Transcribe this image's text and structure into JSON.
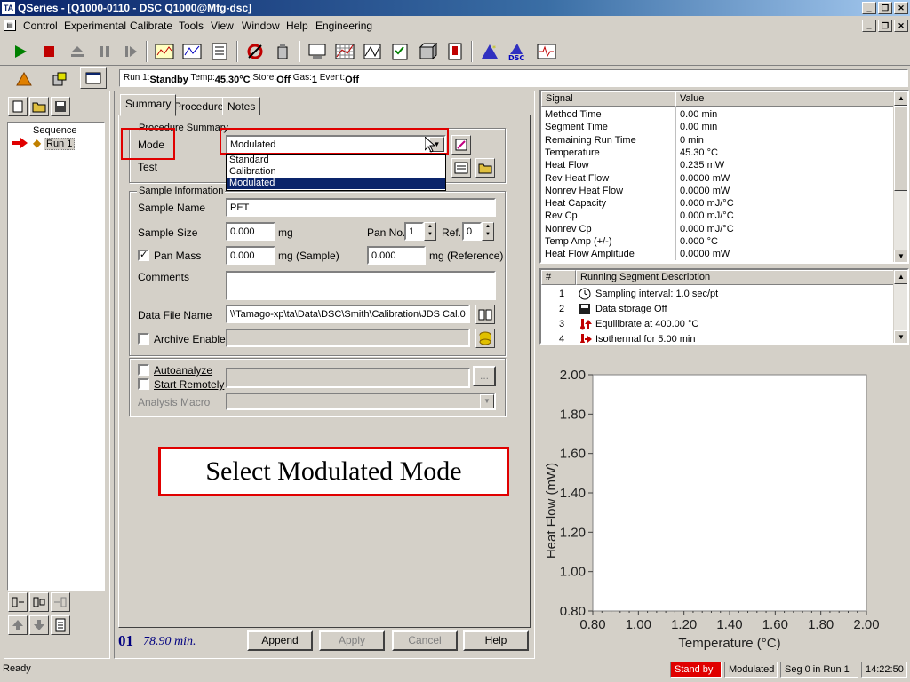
{
  "window": {
    "app_badge": "TA",
    "title": "QSeries - [Q1000-0110 - DSC Q1000@Mfg-dsc]"
  },
  "menu": [
    "Control",
    "Experimental",
    "Calibrate",
    "Tools",
    "View",
    "Window",
    "Help",
    "Engineering"
  ],
  "status_line": {
    "run_label": "Run 1:",
    "run_value": "Standby",
    "temp_label": "Temp:",
    "temp_value": "45.30°C",
    "store_label": "Store:",
    "store_value": "Off",
    "gas_label": "Gas:",
    "gas_value": "1",
    "event_label": "Event:",
    "event_value": "Off"
  },
  "tree": {
    "root": "Sequence",
    "item": "Run 1"
  },
  "tabs": [
    "Summary",
    "Procedure",
    "Notes"
  ],
  "procedure": {
    "group_title": "Procedure Summary",
    "mode_label": "Mode",
    "mode_value": "Modulated",
    "test_label": "Test",
    "options": [
      "Standard",
      "Calibration",
      "Modulated"
    ]
  },
  "sample": {
    "group_title": "Sample Information",
    "name_label": "Sample Name",
    "name_value": "PET",
    "size_label": "Sample Size",
    "size_value": "0.000",
    "size_unit": "mg",
    "pan_no_label": "Pan No.",
    "pan_no_value": "1",
    "ref_label": "Ref.",
    "ref_value": "0",
    "pan_mass_label": "Pan Mass",
    "pan_mass_sample": "0.000",
    "pan_mass_sample_unit": "mg (Sample)",
    "pan_mass_ref": "0.000",
    "pan_mass_ref_unit": "mg (Reference)",
    "comments_label": "Comments",
    "datafile_label": "Data File Name",
    "datafile_value": "\\\\Tamago-xp\\ta\\Data\\DSC\\Smith\\Calibration\\JDS Cal.0",
    "archive_label": "Archive Enable"
  },
  "analysis": {
    "autoanalyze_label": "Autoanalyze",
    "start_remotely_label": "Start Remotely",
    "macro_label": "Analysis Macro",
    "browse_label": "..."
  },
  "callout": "Select Modulated Mode",
  "footer": {
    "run_number": "01",
    "run_time": "78.90 min.",
    "append": "Append",
    "apply": "Apply",
    "cancel": "Cancel",
    "help": "Help"
  },
  "signal_table": {
    "headers": [
      "Signal",
      "Value"
    ],
    "rows": [
      [
        "Method Time",
        "0.00 min"
      ],
      [
        "Segment Time",
        "0.00 min"
      ],
      [
        "Remaining Run Time",
        "0 min"
      ],
      [
        "Temperature",
        "45.30 °C"
      ],
      [
        "Heat Flow",
        "0.235 mW"
      ],
      [
        "Rev Heat Flow",
        "0.0000 mW"
      ],
      [
        "Nonrev Heat Flow",
        "0.0000 mW"
      ],
      [
        "Heat Capacity",
        "0.000 mJ/°C"
      ],
      [
        "Rev Cp",
        "0.000 mJ/°C"
      ],
      [
        "Nonrev Cp",
        "0.000 mJ/°C"
      ],
      [
        "Temp Amp (+/-)",
        "0.000 °C"
      ],
      [
        "Heat Flow Amplitude",
        "0.0000 mW"
      ]
    ]
  },
  "segment_table": {
    "headers": [
      "#",
      "Running Segment Description"
    ],
    "rows": [
      [
        "1",
        "Sampling interval: 1.0 sec/pt"
      ],
      [
        "2",
        "Data storage Off"
      ],
      [
        "3",
        "Equilibrate at 400.00 °C"
      ],
      [
        "4",
        "Isothermal for 5.00 min"
      ]
    ]
  },
  "chart_data": {
    "type": "line",
    "series": [],
    "xlabel": "Temperature (°C)",
    "ylabel": "Heat Flow (mW)",
    "xlim": [
      0.8,
      2.0
    ],
    "ylim": [
      0.8,
      2.0
    ],
    "x_ticks": [
      "0.80",
      "1.00",
      "1.20",
      "1.40",
      "1.60",
      "1.80",
      "2.00"
    ],
    "y_ticks": [
      "0.80",
      "1.00",
      "1.20",
      "1.40",
      "1.60",
      "1.80",
      "2.00"
    ],
    "grid": false
  },
  "status_bar": {
    "ready": "Ready",
    "state": "Stand by",
    "mode": "Modulated",
    "segment": "Seg  0 in Run  1",
    "clock": "14:22:50"
  },
  "colors": {
    "accent_red": "#e00000",
    "title_blue": "#0a246a",
    "selection": "#0a246a"
  }
}
